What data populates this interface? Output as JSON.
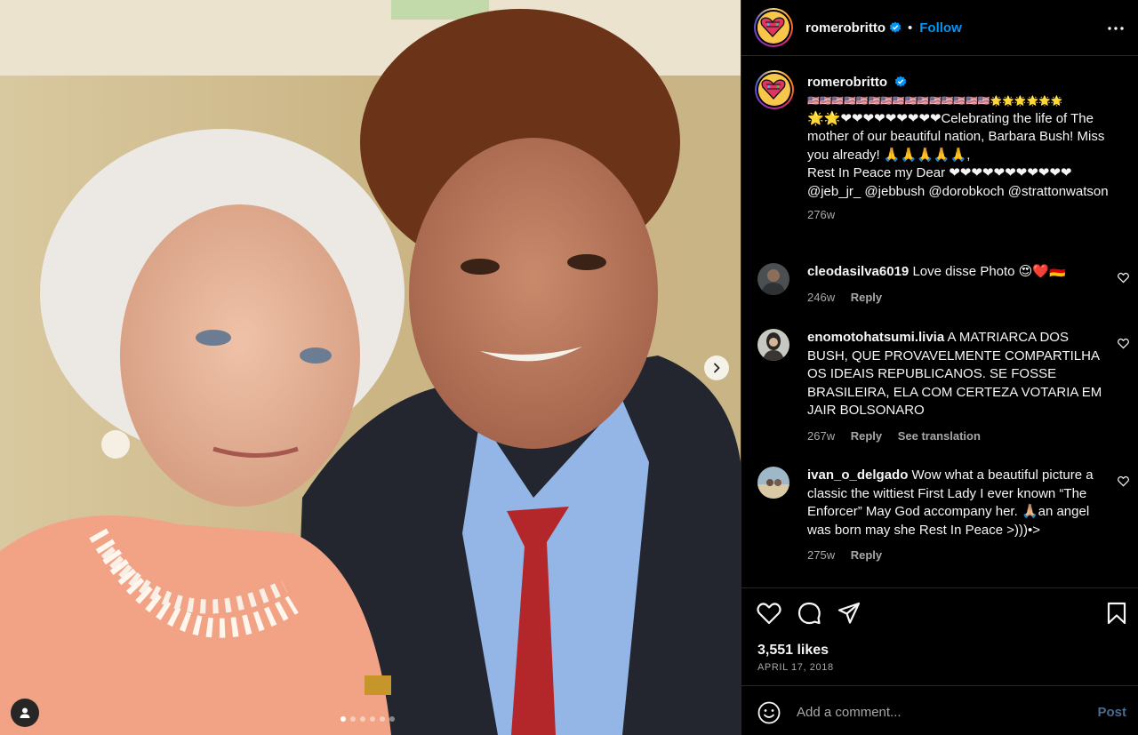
{
  "post": {
    "username": "romerobritto",
    "separator": "•",
    "follow_label": "Follow",
    "caption_line_1": "🇺🇸🇺🇸🇺🇸🇺🇸🇺🇸🇺🇸🇺🇸🇺🇸🇺🇸🇺🇸🇺🇸🇺🇸🇺🇸🇺🇸🇺🇸🌟🌟🌟🌟🌟🌟",
    "caption_line_2": "🌟🌟❤❤❤❤❤❤❤❤❤Celebrating the life of The mother of our beautiful nation, Barbara Bush! Miss you already! 🙏🙏🙏🙏🙏,",
    "caption_line_3": "Rest In Peace my Dear ❤❤❤❤❤❤❤❤❤❤❤",
    "caption_line_4": "@jeb_jr_ @jebbush @dorobkoch @strattonwatson",
    "age": "276w"
  },
  "comments": [
    {
      "username": "cleodasilva6019",
      "text": "Love disse Photo 😍❤️🇩🇪",
      "age": "246w",
      "reply": "Reply"
    },
    {
      "username": "enomotohatsumi.livia",
      "text": "A MATRIARCA DOS BUSH, QUE PROVAVELMENTE COMPARTILHA OS IDEAIS REPUBLICANOS. SE FOSSE BRASILEIRA, ELA COM CERTEZA VOTARIA EM JAIR BOLSONARO",
      "age": "267w",
      "reply": "Reply",
      "translate": "See translation"
    },
    {
      "username": "ivan_o_delgado",
      "text": "Wow what a beautiful picture a classic the wittiest First Lady I ever known “The Enforcer” May God accompany her. 🙏🏼an angel was born may she Rest In Peace >)))•>",
      "age": "275w",
      "reply": "Reply"
    }
  ],
  "stats": {
    "likes": "3,551 likes",
    "date": "APRIL 17, 2018"
  },
  "add_comment": {
    "placeholder": "Add a comment...",
    "post_label": "Post"
  },
  "carousel": {
    "slide_count": 6,
    "active_index": 0
  },
  "icons": {
    "header": [
      "verified-badge-icon",
      "more-options-icon"
    ],
    "media": [
      "next-slide-icon",
      "tagged-user-icon"
    ],
    "actions": [
      "like-icon",
      "comment-icon",
      "share-icon",
      "save-icon"
    ],
    "comment": [
      "comment-like-icon",
      "emoji-icon"
    ]
  },
  "colors": {
    "background": "#000000",
    "text": "#f5f5f5",
    "secondary_text": "#a8a8a8",
    "accent": "#0095f6",
    "divider": "#262626"
  }
}
